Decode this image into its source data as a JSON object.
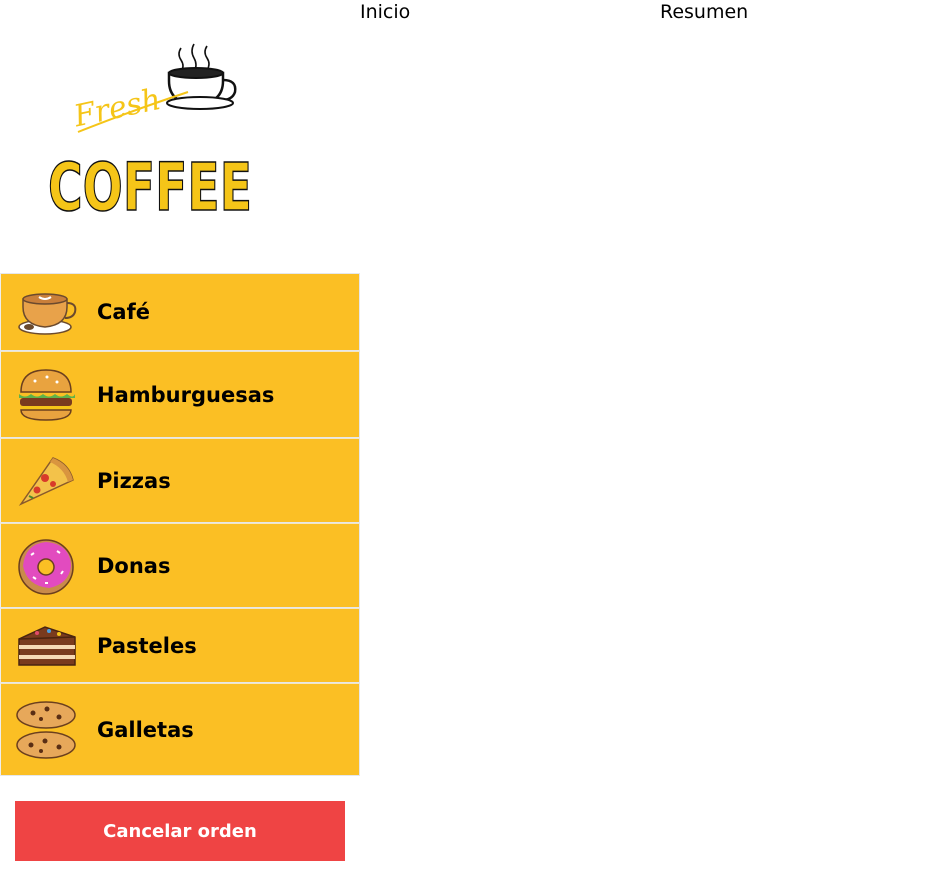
{
  "nav": {
    "inicio": "Inicio",
    "resumen": "Resumen"
  },
  "logo": {
    "top_text": "Fresh",
    "main_text": "COFFEE",
    "icon": "coffee-cup-icon"
  },
  "categories": [
    {
      "label": "Café",
      "icon": "coffee-icon"
    },
    {
      "label": "Hamburguesas",
      "icon": "burger-icon"
    },
    {
      "label": "Pizzas",
      "icon": "pizza-icon"
    },
    {
      "label": "Donas",
      "icon": "donut-icon"
    },
    {
      "label": "Pasteles",
      "icon": "cake-icon"
    },
    {
      "label": "Galletas",
      "icon": "cookie-icon"
    }
  ],
  "actions": {
    "cancel_label": "Cancelar orden"
  },
  "colors": {
    "category_bg": "#fbbf24",
    "cancel_bg": "#ef4444",
    "logo_yellow": "#f5c518"
  }
}
